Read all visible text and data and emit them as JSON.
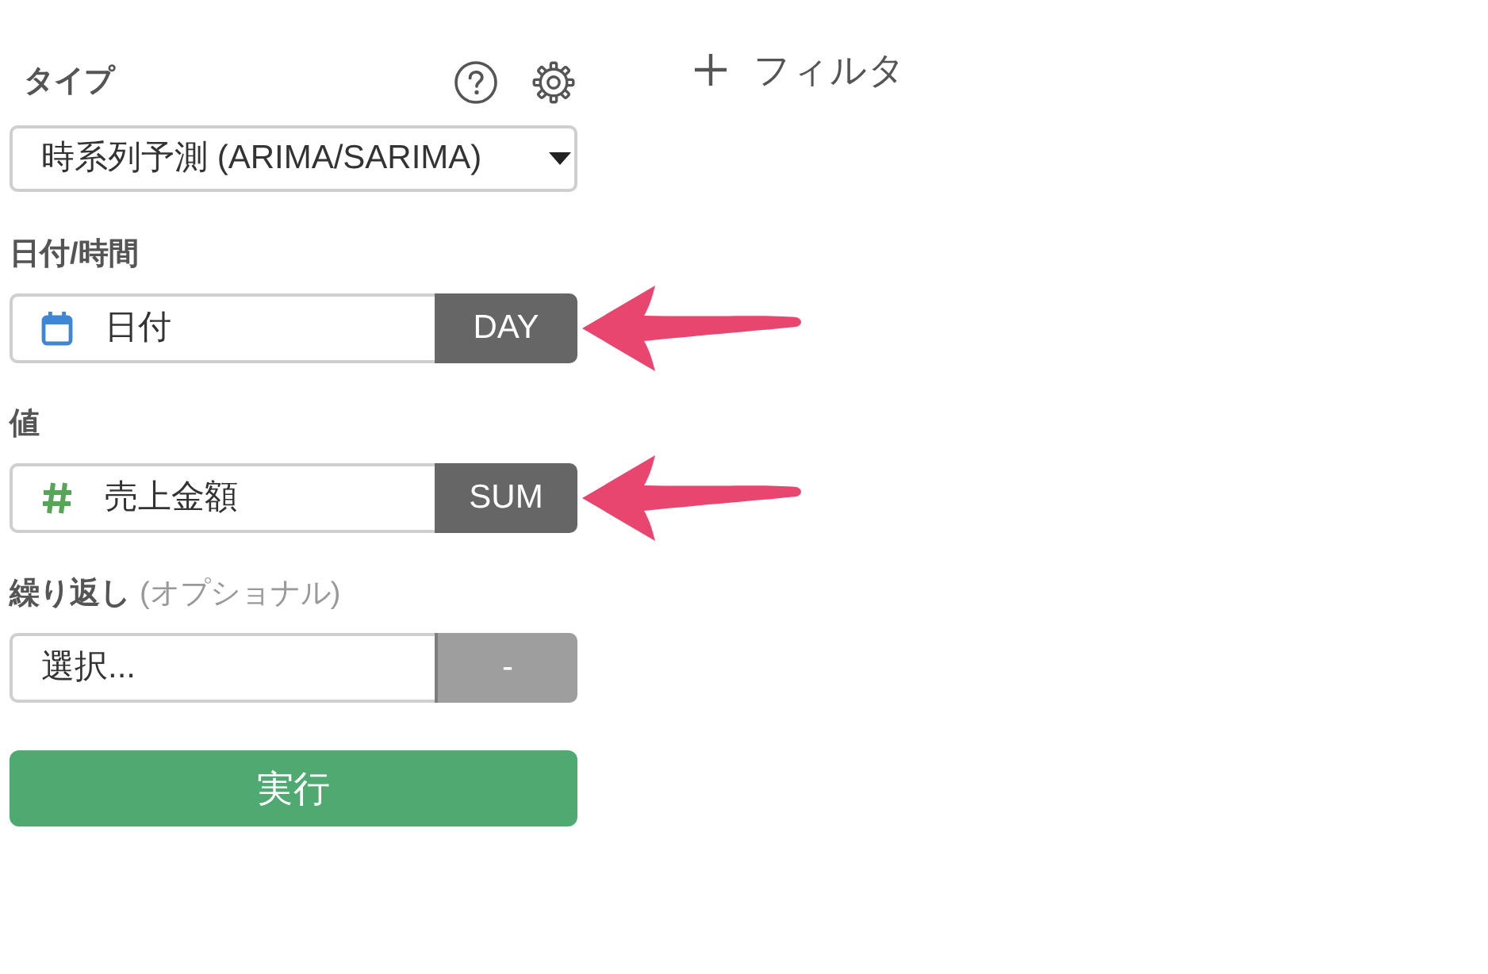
{
  "panel": {
    "type_section": {
      "label": "タイプ",
      "select": {
        "value": "時系列予測 (ARIMA/SARIMA)"
      }
    },
    "fields": [
      {
        "label": "日付/時間",
        "kind": "date",
        "value": "日付",
        "aggregation": {
          "label": "DAY",
          "disabled": false
        },
        "annotated": true
      },
      {
        "label": "値",
        "kind": "number",
        "value": "売上金額",
        "aggregation": {
          "label": "SUM",
          "disabled": false
        },
        "annotated": true
      },
      {
        "label": "繰り返し",
        "note": "(オプショナル)",
        "kind": "none",
        "placeholder": "選択...",
        "aggregation": {
          "label": "-",
          "disabled": true
        },
        "annotated": false
      }
    ],
    "run_button": "実行"
  },
  "filter_button": {
    "label": "フィルタ"
  }
}
